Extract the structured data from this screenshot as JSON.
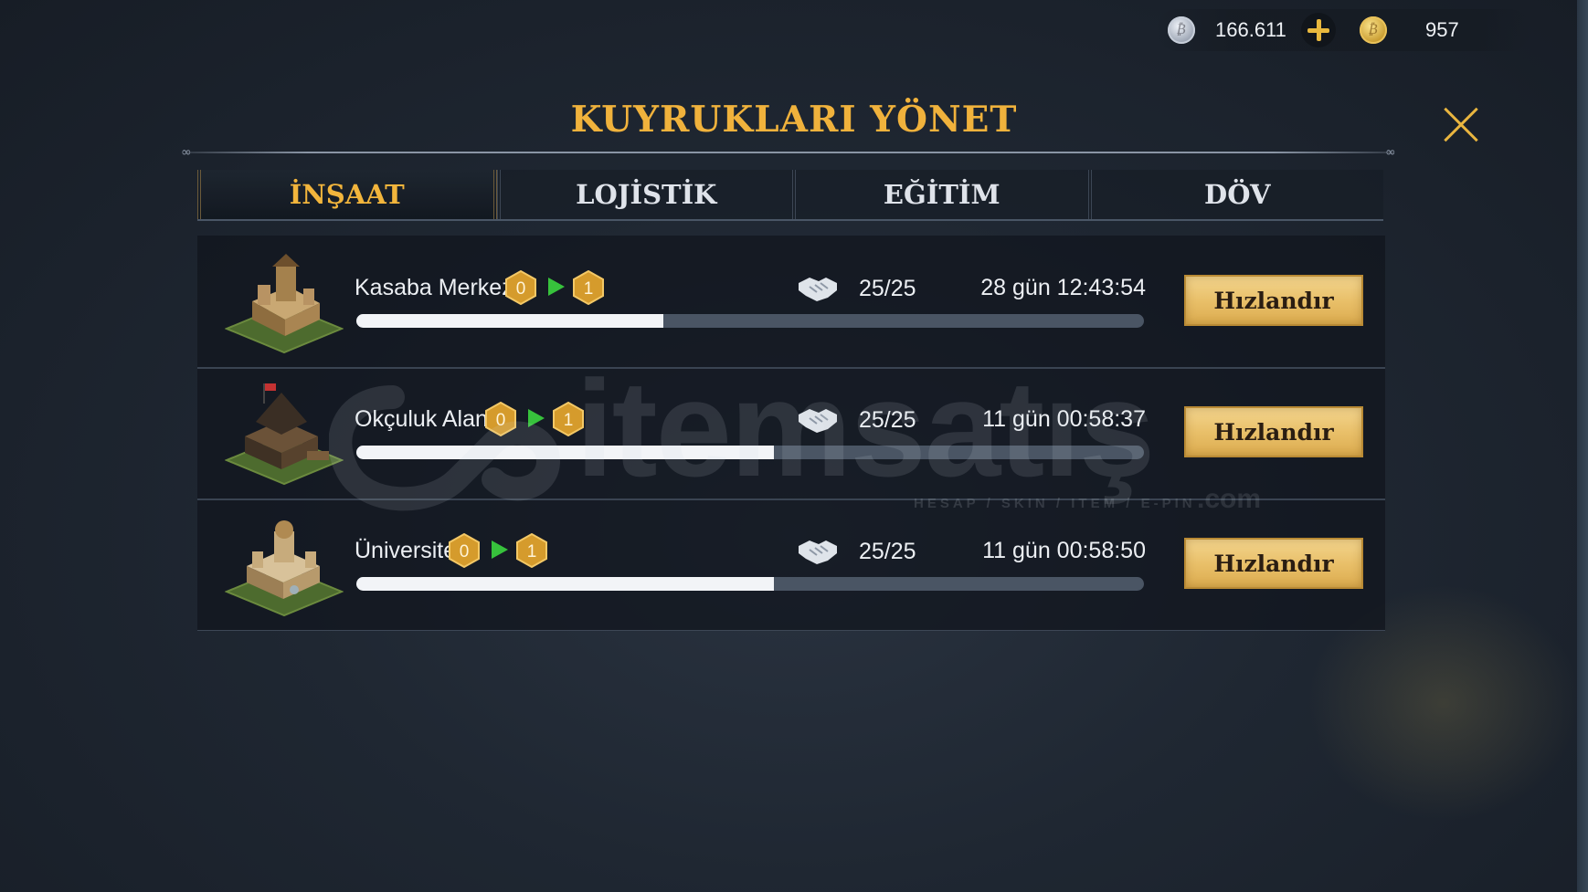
{
  "currency": {
    "silver_value": "166.611",
    "gold_value": "957"
  },
  "title": "KUYRUKLARI YÖNET",
  "tabs": [
    {
      "label": "İNŞAAT",
      "active": true
    },
    {
      "label": "LOJİSTİK",
      "active": false
    },
    {
      "label": "EĞİTİM",
      "active": false
    },
    {
      "label": "DÖV",
      "active": false
    }
  ],
  "queues": [
    {
      "name": "Kasaba Merkezi",
      "level_from": "0",
      "level_to": "1",
      "help": "25/25",
      "time": "28 gün 12:43:54",
      "progress": 0.39,
      "button": "Hızlandır"
    },
    {
      "name": "Okçuluk Alanı",
      "level_from": "0",
      "level_to": "1",
      "help": "25/25",
      "time": "11 gün 00:58:37",
      "progress": 0.53,
      "button": "Hızlandır"
    },
    {
      "name": "Üniversite",
      "level_from": "0",
      "level_to": "1",
      "help": "25/25",
      "time": "11 gün 00:58:50",
      "progress": 0.53,
      "button": "Hızlandır"
    }
  ],
  "watermark": {
    "brand": "itemsatış",
    "tagline": "HESAP / SKIN / ITEM / E-PIN",
    "suffix": ".com"
  },
  "colors": {
    "title": "#f0b23c",
    "button": "#e9c06a",
    "arrow": "#37c23c",
    "progress": "#f2f4f7"
  }
}
